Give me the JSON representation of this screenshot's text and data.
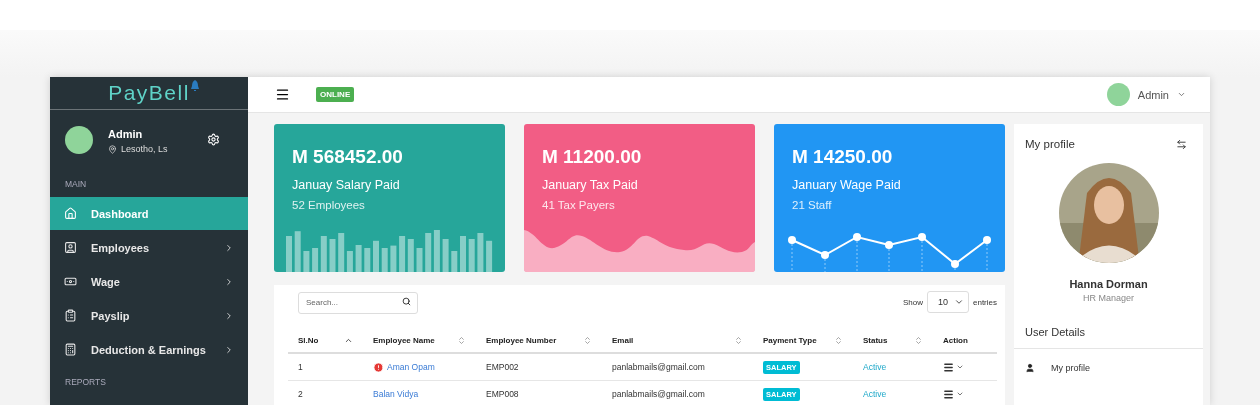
{
  "sidebar": {
    "logo": "PayBell",
    "user": {
      "name": "Admin",
      "location": "Lesotho, Ls"
    },
    "sections": [
      {
        "title": "MAIN",
        "items": [
          {
            "label": "Dashboard",
            "selected": true,
            "expandable": false
          },
          {
            "label": "Employees",
            "selected": false,
            "expandable": true
          },
          {
            "label": "Wage",
            "selected": false,
            "expandable": true
          },
          {
            "label": "Payslip",
            "selected": false,
            "expandable": true
          },
          {
            "label": "Deduction & Earnings",
            "selected": false,
            "expandable": true
          }
        ]
      },
      {
        "title": "REPORTS"
      }
    ]
  },
  "topbar": {
    "status_badge": "ONLINE",
    "user": "Admin"
  },
  "cards": [
    {
      "amount": "M 568452.00",
      "title": "Januay Salary Paid",
      "subtitle": "52 Employees",
      "color": "#26a69a",
      "kind": "bars"
    },
    {
      "amount": "M 11200.00",
      "title": "January Tax Paid",
      "subtitle": "41 Tax Payers",
      "color": "#f25d85",
      "kind": "area"
    },
    {
      "amount": "M 14250.00",
      "title": "January Wage Paid",
      "subtitle": "21 Staff",
      "color": "#2196f3",
      "kind": "line"
    }
  ],
  "table": {
    "search_placeholder": "Search...",
    "show_label": "Show",
    "page_size": "10",
    "entries_label": "entries",
    "columns": [
      "Sl.No",
      "Employee Name",
      "Employee Number",
      "Email",
      "Payment Type",
      "Status",
      "Action"
    ],
    "rows": [
      {
        "no": "1",
        "name": "Aman Opam",
        "alert": true,
        "number": "EMP002",
        "email": "panlabmails@gmail.com",
        "payment": "SALARY",
        "status": "Active"
      },
      {
        "no": "2",
        "name": "Balan Vidya",
        "alert": false,
        "number": "EMP008",
        "email": "panlabmails@gmail.com",
        "payment": "SALARY",
        "status": "Active"
      }
    ]
  },
  "profile": {
    "title": "My profile",
    "name": "Hanna Dorman",
    "role": "HR Manager",
    "details_title": "User Details",
    "links": [
      "My profile"
    ]
  }
}
